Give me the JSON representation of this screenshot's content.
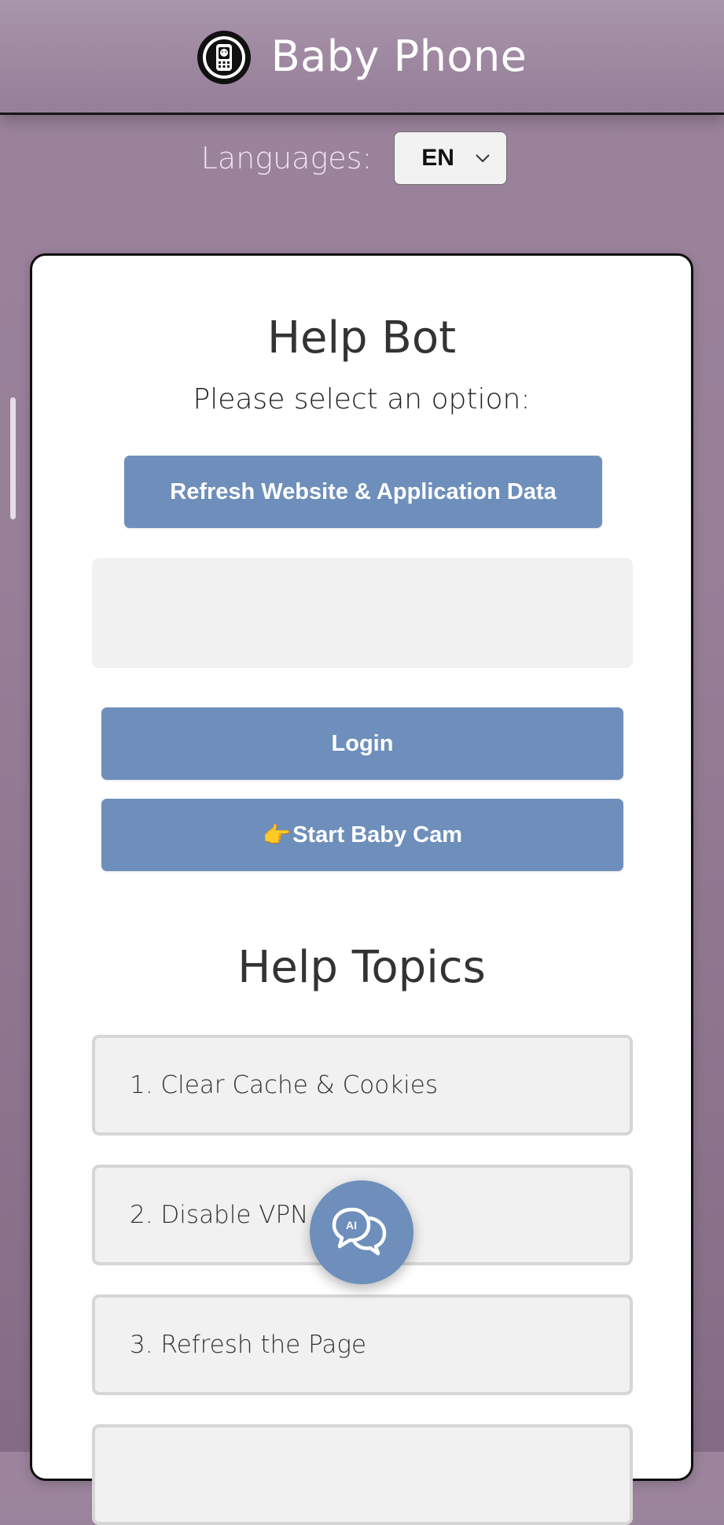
{
  "header": {
    "title": "Baby Phone",
    "logo_icon": "baby-phone-logo-icon"
  },
  "languages": {
    "label": "Languages:",
    "selected": "EN"
  },
  "help_bot": {
    "title": "Help Bot",
    "subtitle": "Please select an option:",
    "refresh_button": "Refresh Website & Application Data",
    "message_area_text": "",
    "login_button": "Login",
    "start_cam_emoji": "👉",
    "start_cam_button": "Start Baby Cam"
  },
  "help_topics": {
    "title": "Help Topics",
    "items": [
      "1. Clear Cache & Cookies",
      "2. Disable VPN",
      "3. Refresh the Page",
      ""
    ]
  },
  "fab": {
    "label": "AI",
    "icon": "ai-chat-icon"
  },
  "colors": {
    "background": "#967f98",
    "header": "#9e88a0",
    "button": "#6e8fbb",
    "card": "#ffffff",
    "topic_bg": "#f1f1f1",
    "topic_border": "#d6d6d6"
  }
}
